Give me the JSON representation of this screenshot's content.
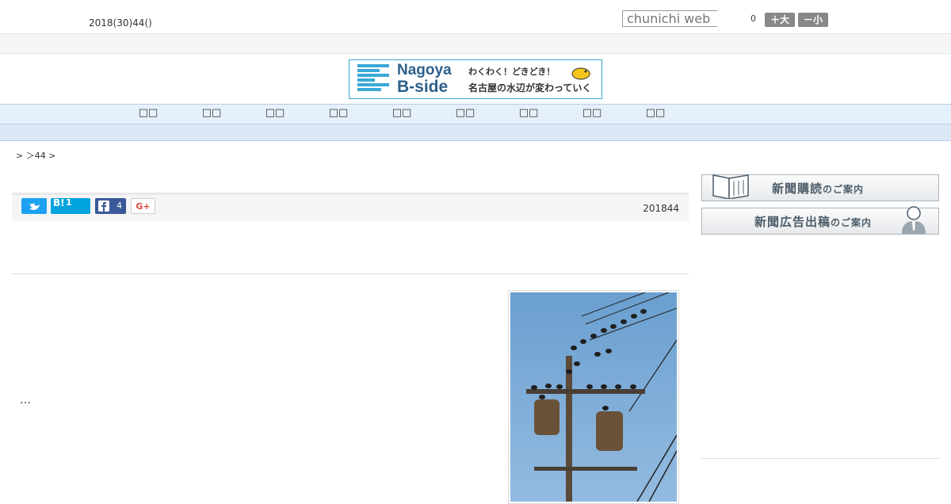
{
  "header": {
    "date": "2018(30)44()",
    "search_placeholder": "chunichi web",
    "count": "0",
    "font_big": "＋大",
    "font_small": "－小"
  },
  "banner": {
    "title_en_1": "Nagoya",
    "title_en_2": "B-side",
    "tagline_1": "わくわく！どきどき！",
    "tagline_2": "名古屋の水辺が変わっていく"
  },
  "nav": {
    "items": [
      "□□",
      "□□",
      "□□",
      "□□",
      "□□",
      "□□",
      "□□",
      "□□",
      "□□"
    ]
  },
  "breadcrumb": "> ＞44 >",
  "share": {
    "twitter_icon": "twitter-icon",
    "hatena_label": "B!",
    "hatena_count": "1",
    "facebook_count": "4",
    "gplus_label": "G+",
    "pub_date": "201844"
  },
  "article": {
    "ellipsis": "…"
  },
  "sidebar": {
    "subscribe_main": "新聞購読",
    "subscribe_sub": "のご案内",
    "ad_main": "新聞広告出稿",
    "ad_sub": "のご案内"
  },
  "colors": {
    "nav_bg": "#e6f0fa",
    "twitter": "#1da1f2",
    "hatena": "#00a4de",
    "facebook": "#3b5998",
    "gplus": "#dd4b39",
    "banner_border": "#39a7c9"
  }
}
